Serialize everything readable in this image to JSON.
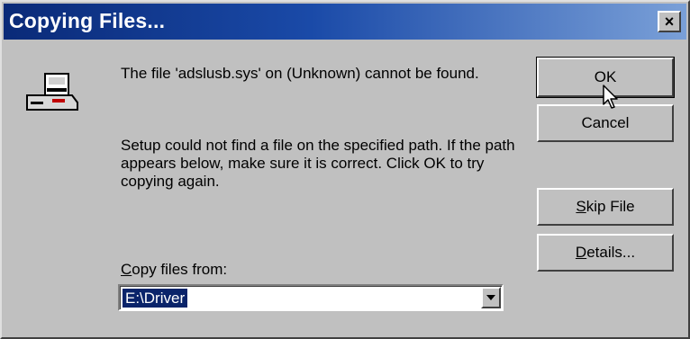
{
  "dialog": {
    "title": "Copying Files...",
    "close_label": "×",
    "message_line1": "The file 'adslusb.sys' on (Unknown) cannot be found.",
    "message_line2": "Setup could not find a file on the specified path. If the path appears below, make sure it is correct. Click OK to try copying again.",
    "copy_from_label_accel": "C",
    "copy_from_label_rest": "opy files from:",
    "path_value": "E:\\Driver"
  },
  "buttons": {
    "ok_label": "OK",
    "cancel_label": "Cancel",
    "skip_accel": "S",
    "skip_rest": "kip File",
    "details_accel": "D",
    "details_rest": "etails..."
  },
  "icons": {
    "device": "disk-drive-icon",
    "dropdown": "chevron-down-icon",
    "cursor": "mouse-pointer-icon"
  },
  "colors": {
    "title_bar_start": "#0a2a78",
    "title_bar_end": "#7aa0d8",
    "selection": "#0a246a",
    "face": "#c0c0c0"
  }
}
